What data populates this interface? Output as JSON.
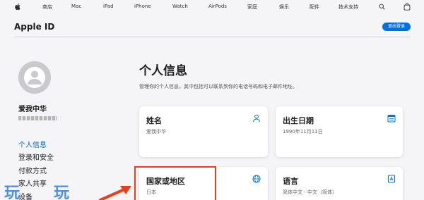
{
  "topnav": {
    "items": [
      "商店",
      "Mac",
      "iPad",
      "iPhone",
      "Watch",
      "AirPods",
      "家庭",
      "娱乐",
      "配件",
      "技术支持"
    ]
  },
  "header": {
    "title": "Apple ID",
    "signout_label": "退出登录"
  },
  "sidebar": {
    "user_name": "爱我中华",
    "items": [
      {
        "label": "个人信息",
        "active": true
      },
      {
        "label": "登录和安全",
        "active": false
      },
      {
        "label": "付款方式",
        "active": false
      },
      {
        "label": "家人共享",
        "active": false
      },
      {
        "label": "设备",
        "active": false
      }
    ]
  },
  "main": {
    "title": "个人信息",
    "description": "管理你的个人信息，其中包括可以联系到你的电话号码和电子邮件地址。",
    "cards": [
      {
        "title": "姓名",
        "value": "爱我中华",
        "icon": "person-icon"
      },
      {
        "title": "出生日期",
        "value": "1990年11月11日",
        "icon": "calendar-icon"
      },
      {
        "title": "国家或地区",
        "value": "日本",
        "icon": "globe-icon"
      },
      {
        "title": "语言",
        "value": "简体中文 - 中文（简体）",
        "icon": "language-icon"
      }
    ]
  },
  "watermark": {
    "left": "玩",
    "right": "玩"
  },
  "colors": {
    "accent": "#0071e3",
    "link": "#0066cc",
    "highlight": "#e8401c"
  }
}
